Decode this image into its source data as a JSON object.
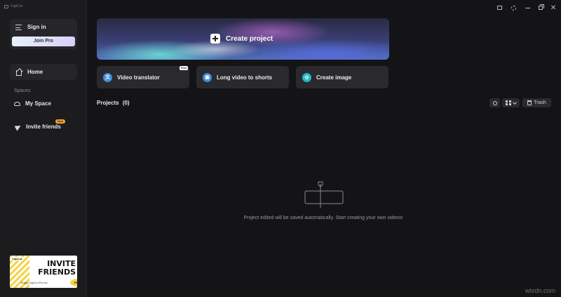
{
  "app": {
    "name": "CapCut"
  },
  "sidebar": {
    "sign_in_label": "Sign in",
    "join_pro_label": "Join Pro",
    "home_label": "Home",
    "spaces_label": "Spaces",
    "my_space_label": "My Space",
    "invite_label": "Invite friends",
    "invite_badge": "New"
  },
  "banner": {
    "brand": "CapCut",
    "line1": "INVITE",
    "line2": "FRIENDS",
    "sub": "Enjoy CapCut Pro for",
    "free": "FREE"
  },
  "main": {
    "create_project_label": "Create project",
    "quick_actions": [
      {
        "label": "Video translator",
        "icon": "translate-icon",
        "badge": "Free"
      },
      {
        "label": "Long video to shorts",
        "icon": "shorts-icon"
      },
      {
        "label": "Create image",
        "icon": "image-icon"
      }
    ],
    "projects_label": "Projects",
    "projects_count": "(0)",
    "trash_label": "Trash",
    "empty_message": "Project edited will be saved automatically. Start creating your own videos!"
  },
  "watermark": "wtxdn.com",
  "colors": {
    "background": "#141416",
    "sidebar": "#1c1c1f",
    "card": "#2a2a2e",
    "accent_blue": "#3f8fd9",
    "accent_teal": "#27b7c4",
    "badge_orange": "#f2a23a"
  }
}
